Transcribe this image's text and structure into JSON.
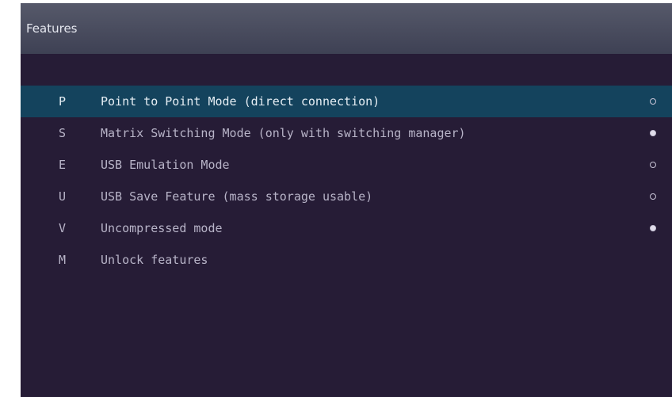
{
  "window": {
    "title": "Features"
  },
  "menu": {
    "items": [
      {
        "key": "P",
        "label": "Point to Point Mode (direct connection)",
        "state": "off",
        "selected": true
      },
      {
        "key": "S",
        "label": "Matrix Switching Mode (only with switching manager)",
        "state": "on",
        "selected": false
      },
      {
        "key": "E",
        "label": "USB Emulation Mode",
        "state": "off",
        "selected": false
      },
      {
        "key": "U",
        "label": "USB Save Feature (mass storage usable)",
        "state": "off",
        "selected": false
      },
      {
        "key": "V",
        "label": "Uncompressed mode",
        "state": "on",
        "selected": false
      },
      {
        "key": "M",
        "label": "Unlock features",
        "state": "none",
        "selected": false
      }
    ]
  },
  "colors": {
    "background": "#261c36",
    "titlebar": "#4a4d5f",
    "selection": "#14435d",
    "text": "#b8b4c8"
  },
  "icons": {
    "indicator_off": "radio-empty-icon",
    "indicator_on": "radio-filled-icon"
  }
}
